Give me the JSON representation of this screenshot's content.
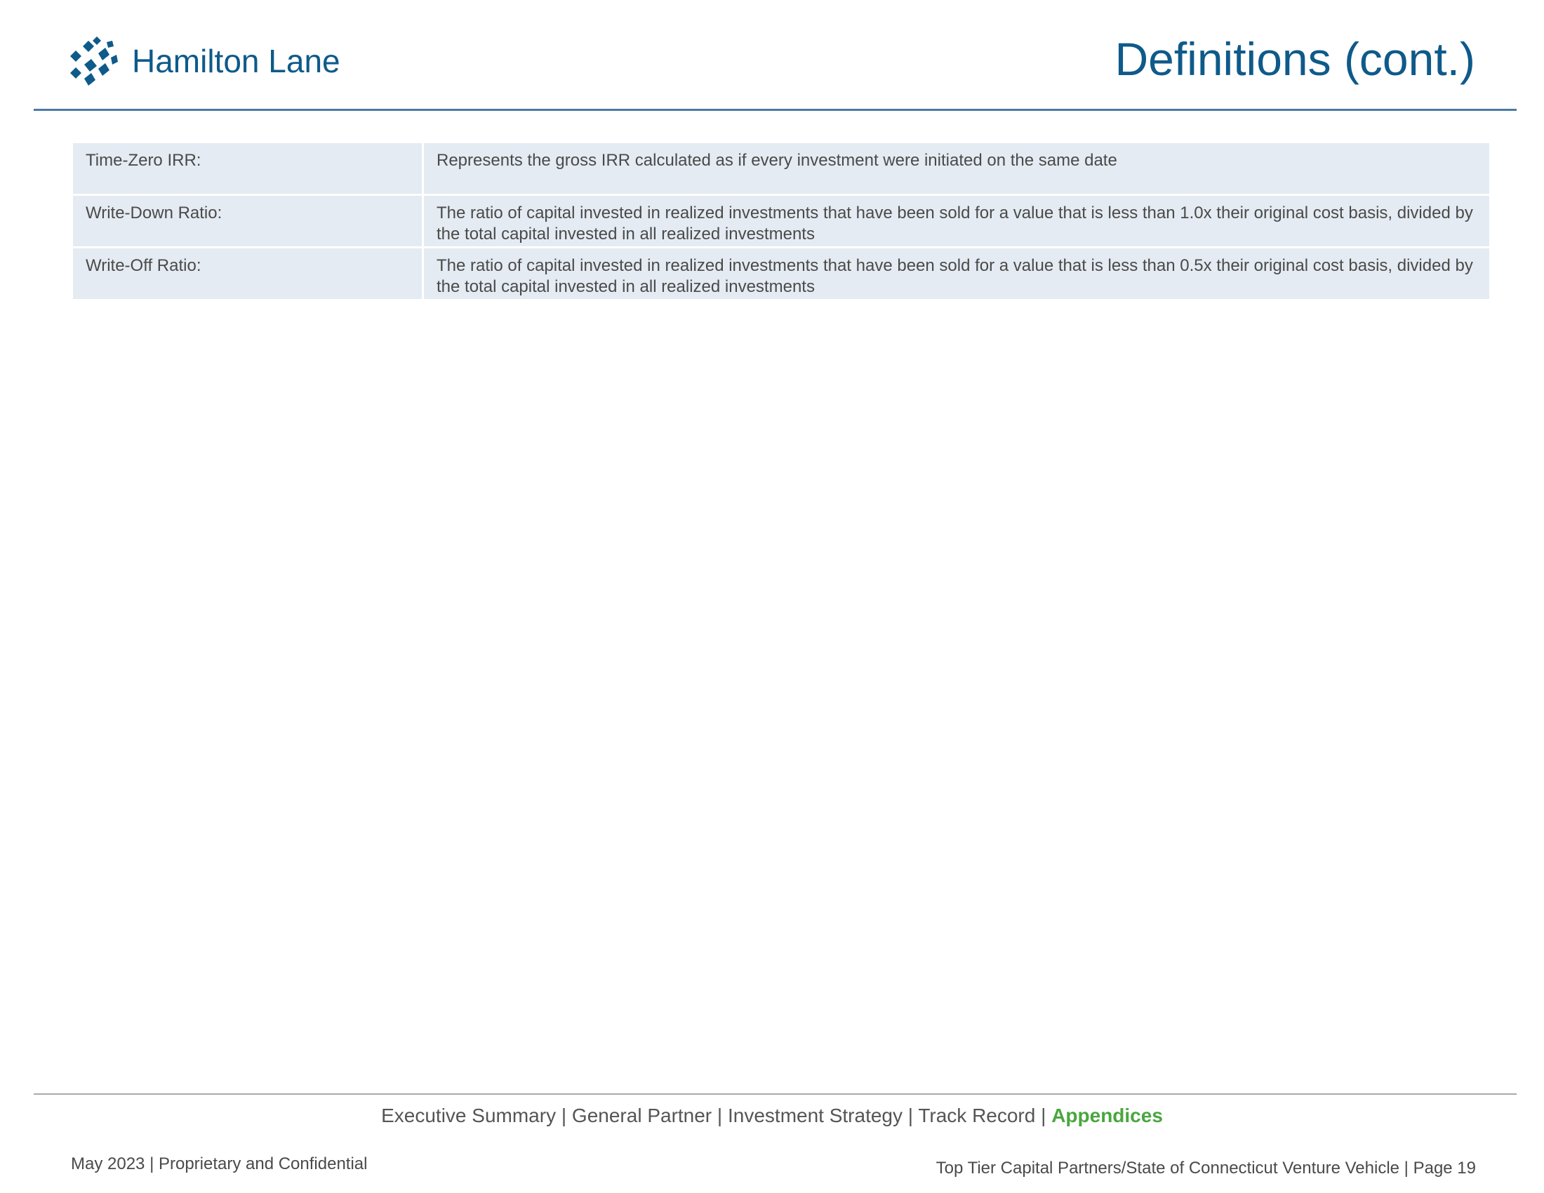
{
  "header": {
    "logo_text": "Hamilton Lane",
    "title": "Definitions (cont.)",
    "brand_color": "#0e5a8a"
  },
  "definitions": [
    {
      "term": "Time-Zero IRR:",
      "definition": "Represents the gross IRR calculated as if every investment were initiated on the same date"
    },
    {
      "term": "Write-Down Ratio:",
      "definition": "The ratio of capital invested in realized investments that have been sold for a value that is less than 1.0x their original cost basis, divided by the total capital invested in all realized investments"
    },
    {
      "term": "Write-Off Ratio:",
      "definition": "The ratio of capital invested in realized investments that have been sold for a value that is less than 0.5x their original cost basis, divided by the total capital invested in all realized investments"
    }
  ],
  "footer": {
    "nav": [
      {
        "label": "Executive Summary",
        "current": false
      },
      {
        "label": "General Partner",
        "current": false
      },
      {
        "label": "Investment Strategy",
        "current": false
      },
      {
        "label": "Track Record",
        "current": false
      },
      {
        "label": "Appendices",
        "current": true
      }
    ],
    "nav_separator": " | ",
    "current_color": "#4aa63f",
    "left_text": "May 2023 | Proprietary and Confidential",
    "right_text": "Top Tier Capital Partners/State of Connecticut Venture Vehicle | Page 19"
  }
}
